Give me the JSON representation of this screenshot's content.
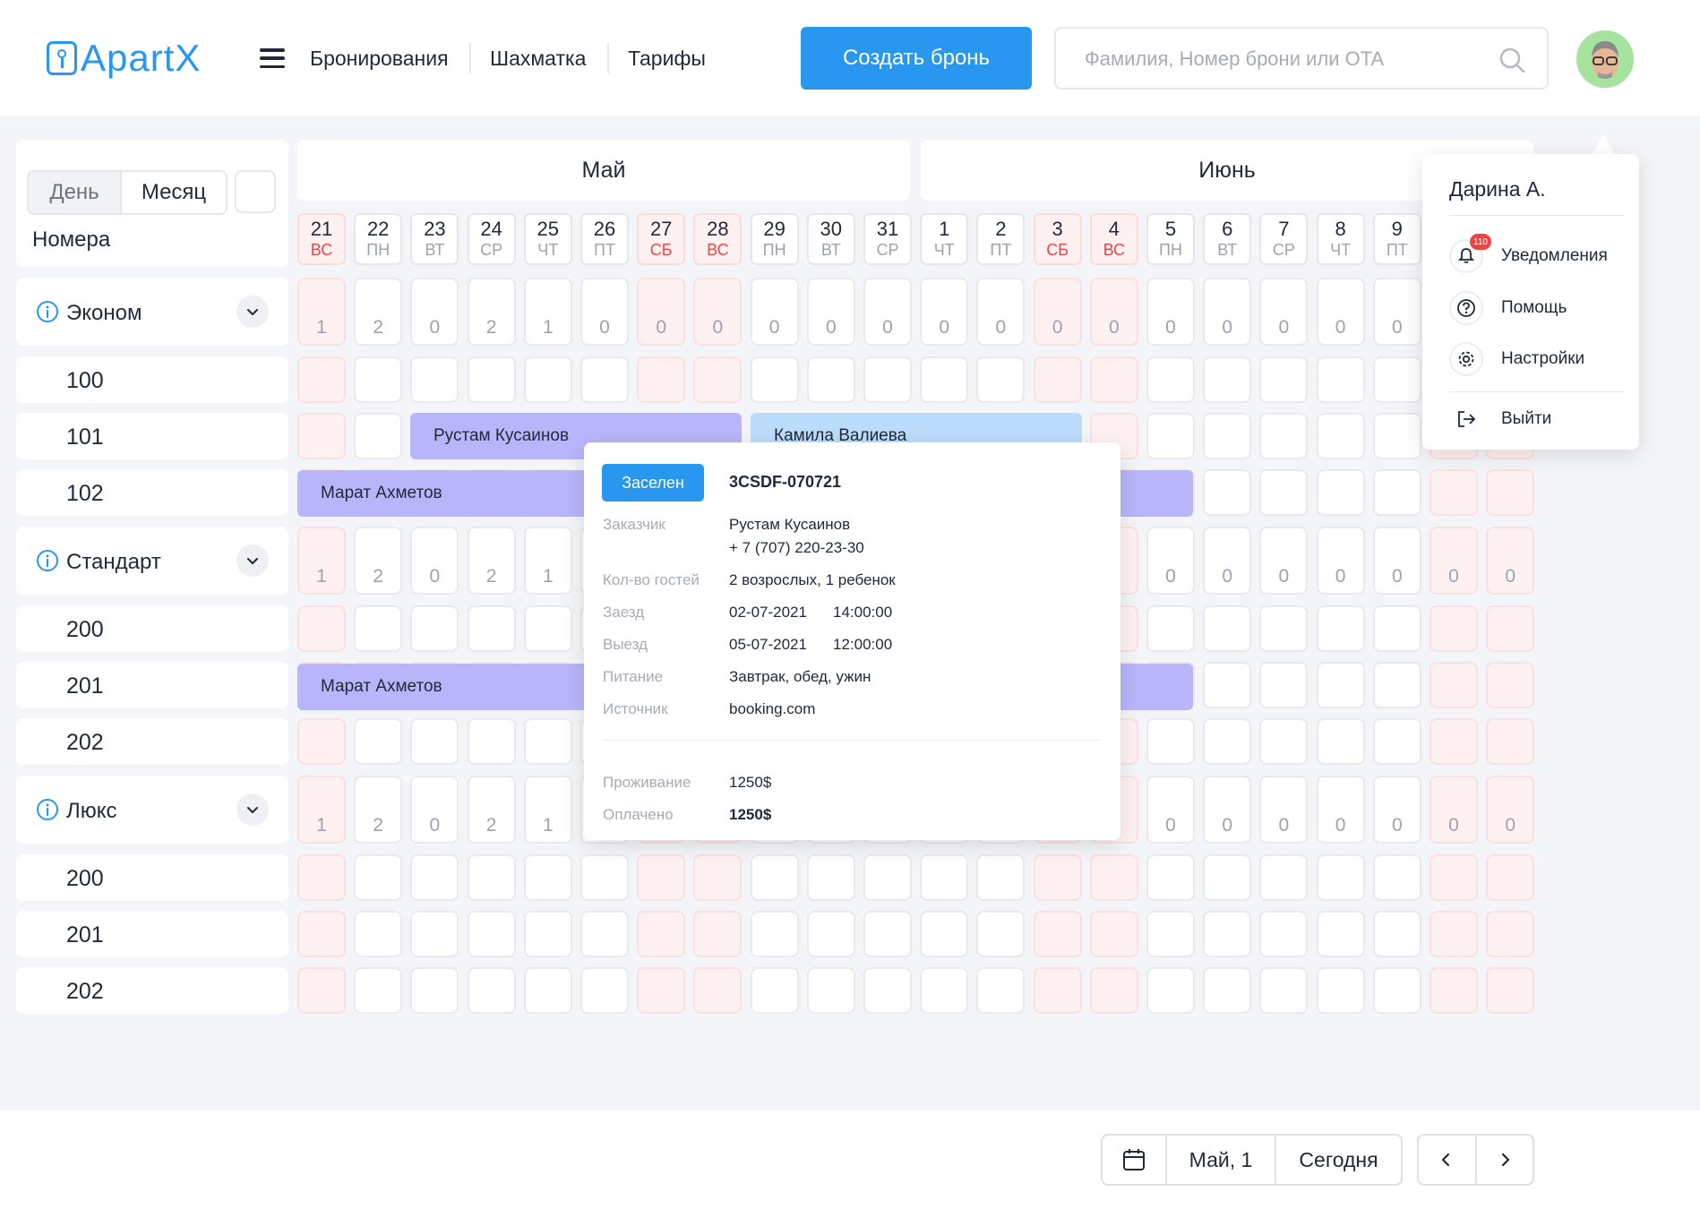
{
  "app": {
    "logo_text": "ApartX"
  },
  "header": {
    "nav": [
      "Бронирования",
      "Шахматка",
      "Тарифы"
    ],
    "create_button": "Создать бронь",
    "search_placeholder": "Фамилия, Номер брони или OTA"
  },
  "view_toggle": {
    "day": "День",
    "month": "Месяц"
  },
  "rooms_label": "Номера",
  "months": [
    "Май",
    "Июнь"
  ],
  "days": [
    {
      "n": "21",
      "wd": "ВС",
      "we": true
    },
    {
      "n": "22",
      "wd": "ПН",
      "we": false
    },
    {
      "n": "23",
      "wd": "ВТ",
      "we": false
    },
    {
      "n": "24",
      "wd": "СР",
      "we": false
    },
    {
      "n": "25",
      "wd": "ЧТ",
      "we": false
    },
    {
      "n": "26",
      "wd": "ПТ",
      "we": false
    },
    {
      "n": "27",
      "wd": "СБ",
      "we": true
    },
    {
      "n": "28",
      "wd": "ВС",
      "we": true
    },
    {
      "n": "29",
      "wd": "ПН",
      "we": false
    },
    {
      "n": "30",
      "wd": "ВТ",
      "we": false
    },
    {
      "n": "31",
      "wd": "СР",
      "we": false
    },
    {
      "n": "1",
      "wd": "ЧТ",
      "we": false
    },
    {
      "n": "2",
      "wd": "ПТ",
      "we": false
    },
    {
      "n": "3",
      "wd": "СБ",
      "we": true
    },
    {
      "n": "4",
      "wd": "ВС",
      "we": true
    },
    {
      "n": "5",
      "wd": "ПН",
      "we": false
    },
    {
      "n": "6",
      "wd": "ВТ",
      "we": false
    },
    {
      "n": "7",
      "wd": "СР",
      "we": false
    },
    {
      "n": "8",
      "wd": "ЧТ",
      "we": false
    },
    {
      "n": "9",
      "wd": "ПТ",
      "we": false
    },
    {
      "n": "",
      "wd": "",
      "we": true
    },
    {
      "n": "",
      "wd": "",
      "we": true
    }
  ],
  "categories": [
    {
      "name": "Эконом",
      "counts": [
        "1",
        "2",
        "0",
        "2",
        "1",
        "0",
        "0",
        "0",
        "0",
        "0",
        "0",
        "0",
        "0",
        "0",
        "0",
        "0",
        "0",
        "0",
        "0",
        "0",
        "",
        ""
      ],
      "rooms": [
        "100",
        "101",
        "102"
      ]
    },
    {
      "name": "Стандарт",
      "counts": [
        "1",
        "2",
        "0",
        "2",
        "1",
        "",
        "",
        "",
        "",
        "",
        "",
        "",
        "",
        "",
        "",
        "0",
        "0",
        "0",
        "0",
        "0",
        "0",
        "0"
      ],
      "rooms": [
        "200",
        "201",
        "202"
      ]
    },
    {
      "name": "Люкс",
      "counts": [
        "1",
        "2",
        "0",
        "2",
        "1",
        "",
        "",
        "",
        "",
        "",
        "",
        "",
        "",
        "",
        "",
        "0",
        "0",
        "0",
        "0",
        "0",
        "0",
        "0"
      ],
      "rooms": [
        "200",
        "201",
        "202"
      ]
    }
  ],
  "bookings": [
    {
      "guest": "Рустам Кусаинов",
      "color": "#B8B5FA"
    },
    {
      "guest": "Камила Валиева",
      "color": "#BBDDFB"
    },
    {
      "guest": "Марат Ахметов",
      "color": "#B8B5FA"
    },
    {
      "guest": "Марат Ахметов",
      "color": "#B8B5FA"
    }
  ],
  "popover": {
    "status": "Заселен",
    "code": "3CSDF-070721",
    "customer_label": "Заказчик",
    "customer_name": "Рустам Кусаинов",
    "customer_phone": "+ 7 (707) 220-23-30",
    "guests_label": "Кол-во гостей",
    "guests": "2 возрослых, 1 ребенок",
    "checkin_label": "Заезд",
    "checkin_date": "02-07-2021",
    "checkin_time": "14:00:00",
    "checkout_label": "Выезд",
    "checkout_date": "05-07-2021",
    "checkout_time": "12:00:00",
    "meals_label": "Питание",
    "meals": "Завтрак, обед, ужин",
    "source_label": "Источник",
    "source": "booking.com",
    "stay_label": "Проживание",
    "stay": "1250$",
    "paid_label": "Оплачено",
    "paid": "1250$"
  },
  "user_menu": {
    "name": "Дарина А.",
    "notifications": "Уведомления",
    "notifications_count": "110",
    "help": "Помощь",
    "settings": "Настройки",
    "logout": "Выйти"
  },
  "bottom_controls": {
    "date": "Май, 1",
    "today": "Сегодня"
  },
  "colors": {
    "accent": "#2997F0",
    "weekend_bg": "#FFF1F1",
    "weekend_text": "#EF4444"
  }
}
